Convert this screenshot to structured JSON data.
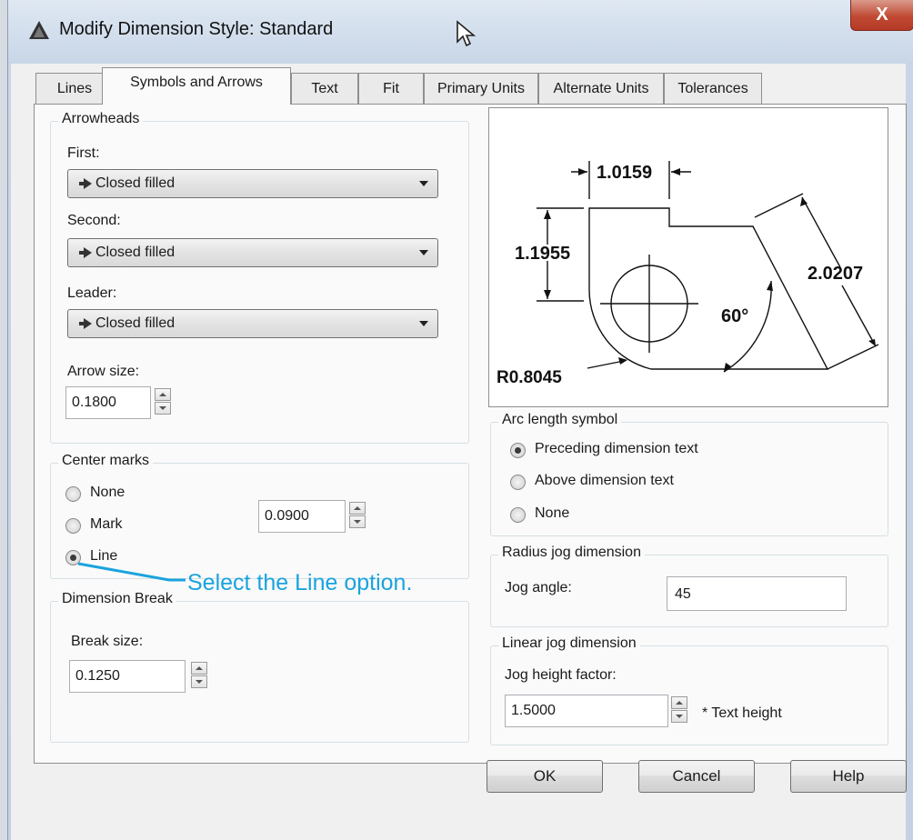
{
  "window": {
    "title": "Modify Dimension Style: Standard",
    "close_label": "X"
  },
  "tabs": [
    {
      "label": "Lines"
    },
    {
      "label": "Symbols and Arrows",
      "active": true
    },
    {
      "label": "Text"
    },
    {
      "label": "Fit"
    },
    {
      "label": "Primary Units"
    },
    {
      "label": "Alternate Units"
    },
    {
      "label": "Tolerances"
    }
  ],
  "arrowheads": {
    "legend": "Arrowheads",
    "first_label": "First:",
    "first_value": "Closed filled",
    "second_label": "Second:",
    "second_value": "Closed filled",
    "leader_label": "Leader:",
    "leader_value": "Closed filled",
    "arrow_size_label": "Arrow size:",
    "arrow_size_value": "0.1800"
  },
  "center_marks": {
    "legend": "Center marks",
    "options": [
      {
        "label": "None"
      },
      {
        "label": "Mark"
      },
      {
        "label": "Line",
        "selected": true
      }
    ],
    "size_value": "0.0900"
  },
  "dimension_break": {
    "legend": "Dimension Break",
    "break_size_label": "Break size:",
    "break_size_value": "0.1250"
  },
  "preview": {
    "dim_top": "1.0159",
    "dim_left": "1.1955",
    "dim_right": "2.0207",
    "angle": "60°",
    "radius": "R0.8045"
  },
  "arc_length": {
    "legend": "Arc length symbol",
    "options": [
      {
        "label": "Preceding dimension text",
        "selected": true
      },
      {
        "label": "Above dimension text"
      },
      {
        "label": "None"
      }
    ]
  },
  "radius_jog": {
    "legend": "Radius jog dimension",
    "jog_angle_label": "Jog angle:",
    "jog_angle_value": "45"
  },
  "linear_jog": {
    "legend": "Linear jog dimension",
    "jog_height_label": "Jog height factor:",
    "jog_height_value": "1.5000",
    "suffix": "* Text height"
  },
  "buttons": {
    "ok": "OK",
    "cancel": "Cancel",
    "help": "Help"
  },
  "annotation": {
    "text": "Select the Line option.",
    "color": "#1aa3de"
  }
}
